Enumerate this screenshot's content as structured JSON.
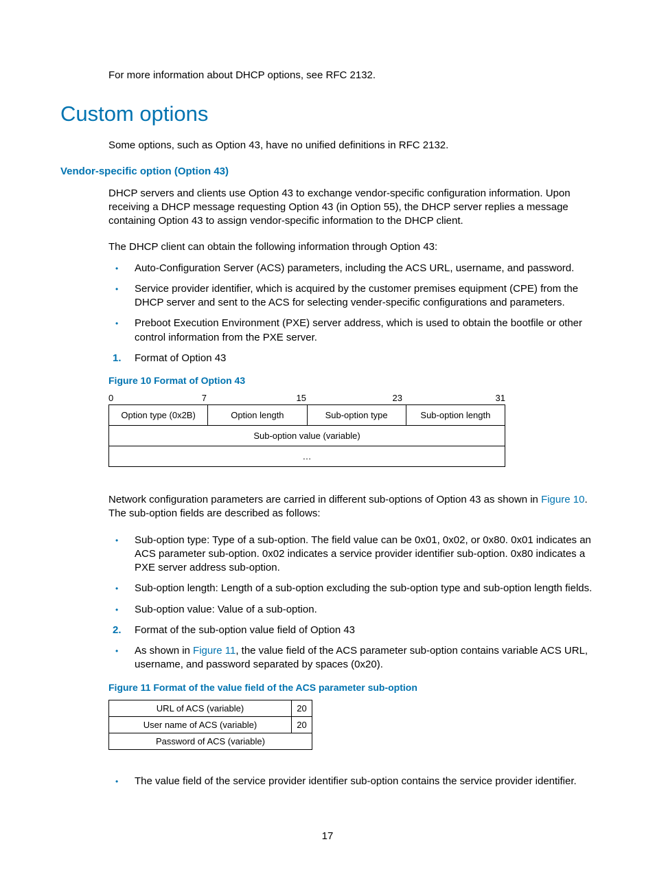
{
  "intro": "For more information about DHCP options, see RFC 2132.",
  "h1": "Custom options",
  "p1": "Some options, such as Option 43, have no unified definitions in RFC 2132.",
  "h3": "Vendor-specific option (Option 43)",
  "p2": "DHCP servers and clients use Option 43 to exchange vendor-specific configuration information. Upon receiving a DHCP message requesting Option 43 (in Option 55), the DHCP server replies a message containing Option 43 to assign vendor-specific information to the DHCP client.",
  "p3": "The DHCP client can obtain the following information through Option 43:",
  "bl1": [
    "Auto-Configuration Server (ACS) parameters, including the ACS URL, username, and password.",
    "Service provider identifier, which is acquired by the customer premises equipment (CPE) from the DHCP server and sent to the ACS for selecting vender-specific configurations and parameters.",
    "Preboot Execution Environment (PXE) server address, which is used to obtain the bootfile or other control information from the PXE server."
  ],
  "num1": {
    "n": "1.",
    "t": "Format of Option 43"
  },
  "fig10cap": "Figure 10 Format of Option 43",
  "chart_data": [
    {
      "type": "table",
      "id": "figure-10",
      "bit_ticks": [
        "0",
        "7",
        "15",
        "23",
        "31"
      ],
      "rows": [
        [
          "Option type (0x2B)",
          "Option length",
          "Sub-option type",
          "Sub-option length"
        ],
        [
          "Sub-option value (variable)"
        ],
        [
          "…"
        ]
      ]
    },
    {
      "type": "table",
      "id": "figure-11",
      "rows": [
        [
          "URL of ACS (variable)",
          "20"
        ],
        [
          "User name of ACS (variable)",
          "20"
        ],
        [
          "Password of ACS (variable)"
        ]
      ]
    }
  ],
  "p4a": "Network configuration parameters are carried in different sub-options of Option 43 as shown in ",
  "p4link": "Figure 10",
  "p4b": ". The sub-option fields are described as follows:",
  "bl2": [
    "Sub-option type: Type of a sub-option. The field value can be 0x01, 0x02, or 0x80. 0x01 indicates an ACS parameter sub-option. 0x02 indicates a service provider identifier sub-option. 0x80 indicates a PXE server address sub-option.",
    "Sub-option length: Length of a sub-option excluding the sub-option type and sub-option length fields.",
    "Sub-option value: Value of a sub-option."
  ],
  "num2": {
    "n": "2.",
    "t": "Format of the sub-option value field of Option 43"
  },
  "bl3a": "As shown in ",
  "bl3link": "Figure 11",
  "bl3b": ", the value field of the ACS parameter sub-option contains variable ACS URL, username, and password separated by spaces (0x20).",
  "fig11cap": "Figure 11 Format of the value field of the ACS parameter sub-option",
  "bl4": "The value field of the service provider identifier sub-option contains the service provider identifier.",
  "pagenum": "17"
}
